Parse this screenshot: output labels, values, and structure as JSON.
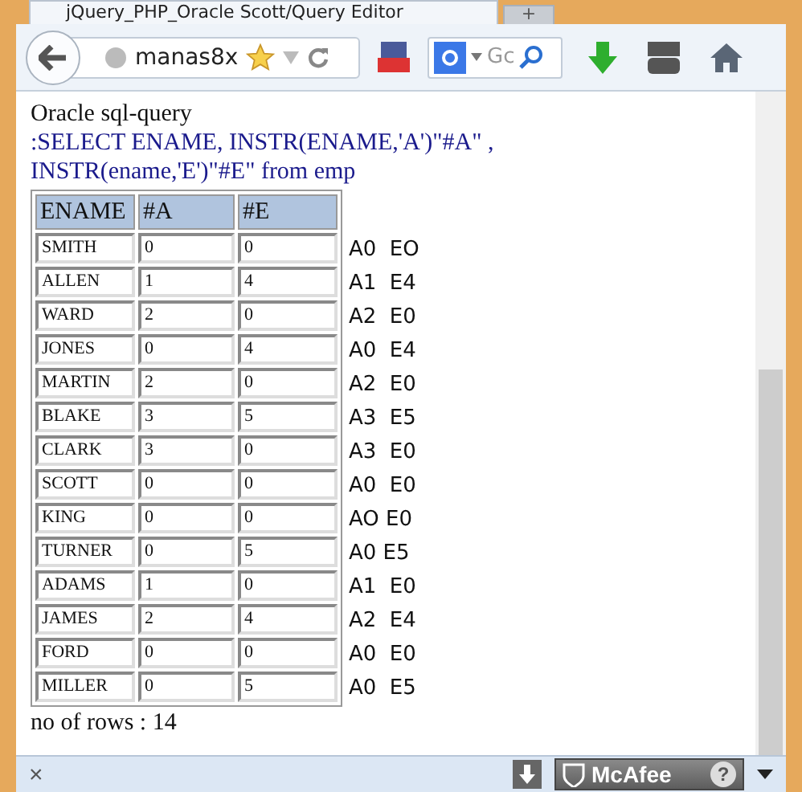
{
  "tab": {
    "title": "jQuery_PHP_Oracle Scott/Query Editor",
    "new_tab": "+"
  },
  "toolbar": {
    "url": "manas8x",
    "search_placeholder": "Gc"
  },
  "content": {
    "heading": "Oracle sql-query",
    "query": ":SELECT ENAME, INSTR(ENAME,'A')\"#A\" , INSTR(ename,'E')\"#E\" from emp",
    "table": {
      "columns": [
        "ENAME",
        "#A",
        "#E"
      ],
      "rows": [
        [
          "SMITH",
          "0",
          "0"
        ],
        [
          "ALLEN",
          "1",
          "4"
        ],
        [
          "WARD",
          "2",
          "0"
        ],
        [
          "JONES",
          "0",
          "4"
        ],
        [
          "MARTIN",
          "2",
          "0"
        ],
        [
          "BLAKE",
          "3",
          "5"
        ],
        [
          "CLARK",
          "3",
          "0"
        ],
        [
          "SCOTT",
          "0",
          "0"
        ],
        [
          "KING",
          "0",
          "0"
        ],
        [
          "TURNER",
          "0",
          "5"
        ],
        [
          "ADAMS",
          "1",
          "0"
        ],
        [
          "JAMES",
          "2",
          "4"
        ],
        [
          "FORD",
          "0",
          "0"
        ],
        [
          "MILLER",
          "0",
          "5"
        ]
      ]
    },
    "annotations": [
      "A0  EO",
      "A1  E4",
      "A2  E0",
      "A0  E4",
      "A2  E0",
      "A3  E5",
      "A3  E0",
      "A0  E0",
      "AO E0",
      "A0 E5",
      "A1  E0",
      "A2  E4",
      "A0  E0",
      "A0  E5"
    ],
    "row_count": "no of rows : 14"
  },
  "status_bar": {
    "close": "×",
    "addon": "McAfee",
    "help": "?"
  }
}
